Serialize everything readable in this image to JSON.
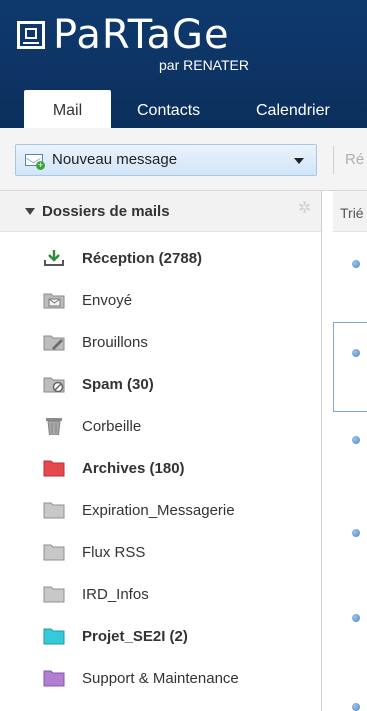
{
  "logo": {
    "name": "PaRTaGe",
    "sub": "par RENATER"
  },
  "tabs": [
    {
      "label": "Mail"
    },
    {
      "label": "Contacts"
    },
    {
      "label": "Calendrier"
    }
  ],
  "toolbar": {
    "new_message": "Nouveau message",
    "reply": "Ré"
  },
  "sidebar": {
    "title": "Dossiers de mails",
    "folders": [
      {
        "label": "Réception (2788)",
        "icon": "inbox-download-icon"
      },
      {
        "label": "Envoyé",
        "icon": "sent-folder-icon"
      },
      {
        "label": "Brouillons",
        "icon": "drafts-folder-icon"
      },
      {
        "label": "Spam (30)",
        "icon": "spam-folder-icon"
      },
      {
        "label": "Corbeille",
        "icon": "trash-icon"
      },
      {
        "label": "Archives (180)",
        "icon": "folder-icon",
        "color": "#e5484d"
      },
      {
        "label": "Expiration_Messagerie",
        "icon": "folder-icon",
        "color": "#c8c8c8"
      },
      {
        "label": "Flux RSS",
        "icon": "folder-icon",
        "color": "#c8c8c8"
      },
      {
        "label": "IRD_Infos",
        "icon": "folder-icon",
        "color": "#c8c8c8"
      },
      {
        "label": "Projet_SE2I (2)",
        "icon": "folder-icon",
        "color": "#36c9d9"
      },
      {
        "label": "Support & Maintenance",
        "icon": "folder-icon",
        "color": "#b07fd0"
      }
    ]
  },
  "list": {
    "sort_label": "Trié"
  },
  "colors": {
    "header": "#0f3a6e",
    "accent": "#a9c8e6"
  }
}
